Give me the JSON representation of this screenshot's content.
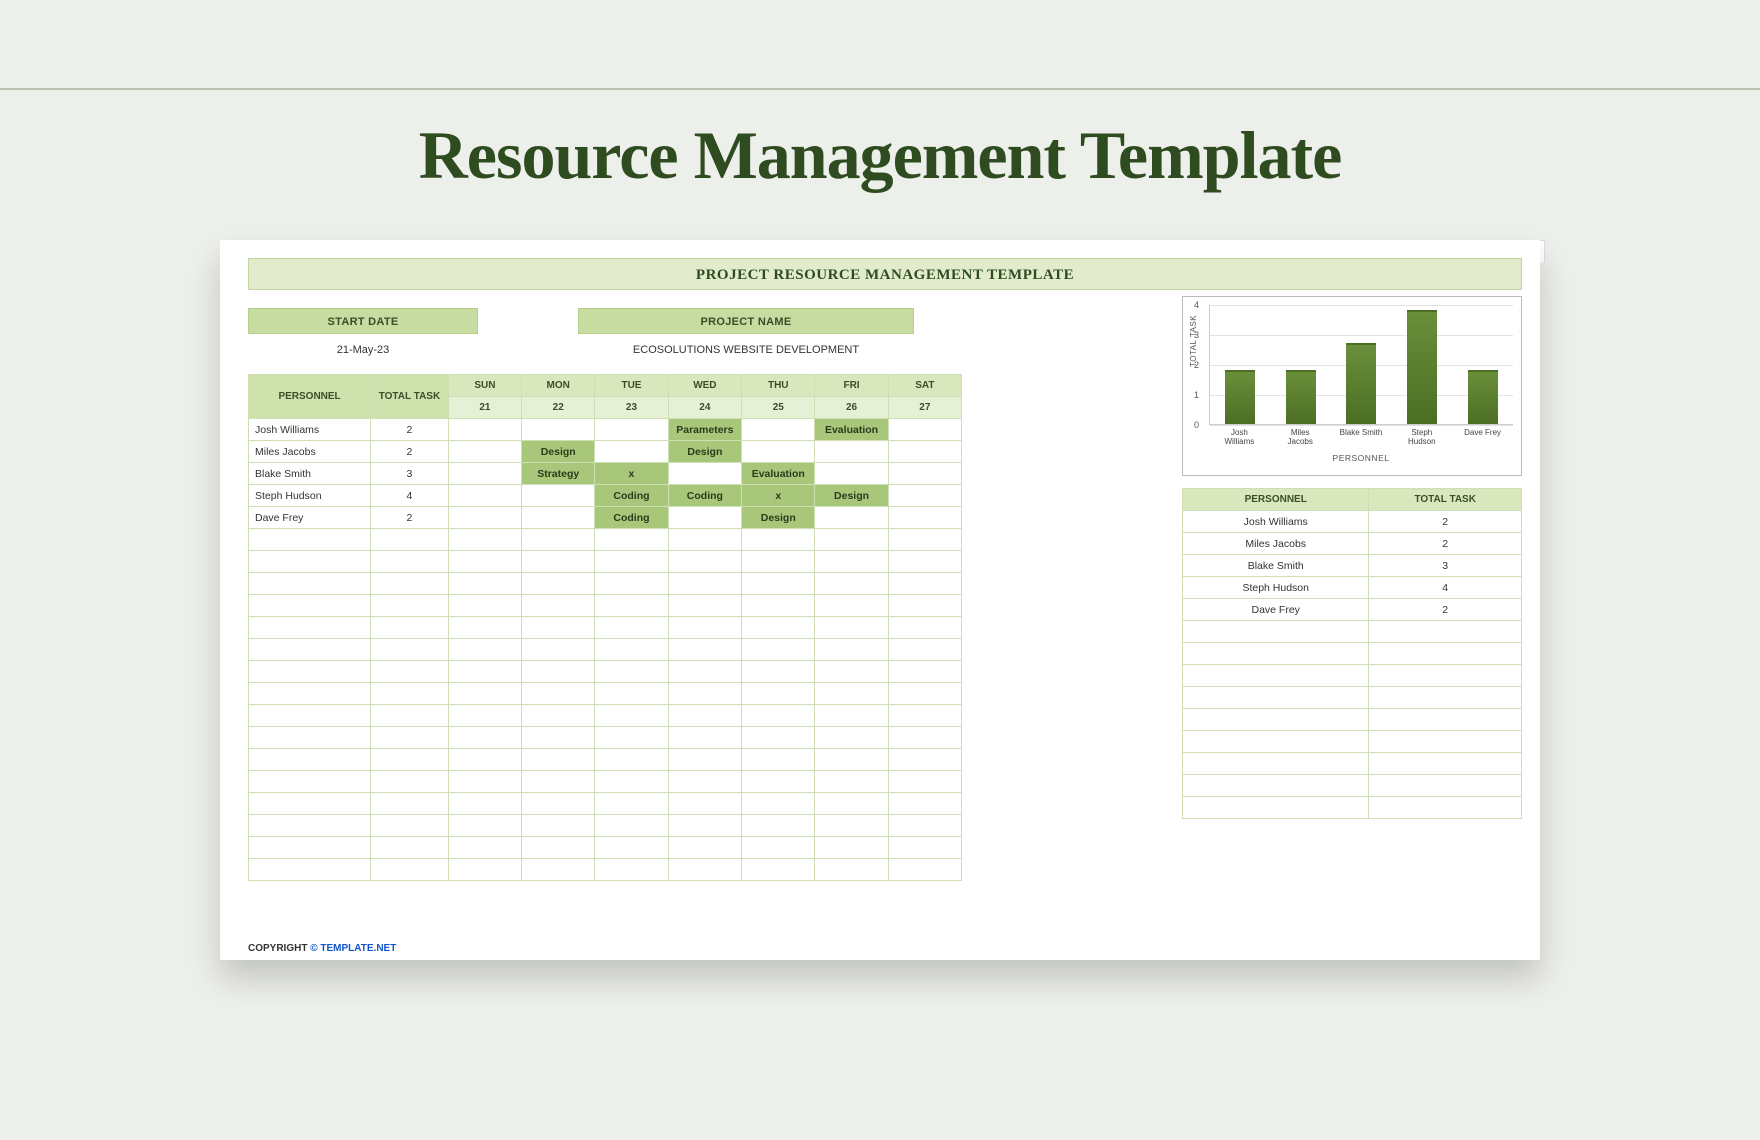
{
  "page": {
    "title": "Resource Management Template"
  },
  "sheet": {
    "banner": "PROJECT RESOURCE MANAGEMENT TEMPLATE",
    "meta": {
      "start_label": "START DATE",
      "start_value": "21-May-23",
      "project_label": "PROJECT NAME",
      "project_value": "ECOSOLUTIONS WEBSITE DEVELOPMENT"
    },
    "columns": {
      "personnel": "PERSONNEL",
      "total_task": "TOTAL TASK",
      "days": [
        "SUN",
        "MON",
        "TUE",
        "WED",
        "THU",
        "FRI",
        "SAT"
      ],
      "daynums": [
        "21",
        "22",
        "23",
        "24",
        "25",
        "26",
        "27"
      ]
    },
    "rows": [
      {
        "name": "Josh Williams",
        "total": "2",
        "cells": [
          "",
          "",
          "",
          "Parameters",
          "",
          "Evaluation",
          ""
        ]
      },
      {
        "name": "Miles Jacobs",
        "total": "2",
        "cells": [
          "",
          "Design",
          "",
          "Design",
          "",
          "",
          ""
        ]
      },
      {
        "name": "Blake Smith",
        "total": "3",
        "cells": [
          "",
          "Strategy",
          "x",
          "",
          "Evaluation",
          "",
          ""
        ]
      },
      {
        "name": "Steph Hudson",
        "total": "4",
        "cells": [
          "",
          "",
          "Coding",
          "Coding",
          "x",
          "Design",
          ""
        ]
      },
      {
        "name": "Dave Frey",
        "total": "2",
        "cells": [
          "",
          "",
          "Coding",
          "",
          "Design",
          "",
          ""
        ]
      }
    ],
    "blank_rows": 16,
    "summary_blank_rows": 9
  },
  "summary": {
    "headers": {
      "personnel": "PERSONNEL",
      "total_task": "TOTAL TASK"
    },
    "rows": [
      {
        "name": "Josh Williams",
        "total": "2"
      },
      {
        "name": "Miles Jacobs",
        "total": "2"
      },
      {
        "name": "Blake Smith",
        "total": "3"
      },
      {
        "name": "Steph Hudson",
        "total": "4"
      },
      {
        "name": "Dave Frey",
        "total": "2"
      }
    ]
  },
  "chart_data": {
    "type": "bar",
    "categories": [
      "Josh Williams",
      "Miles Jacobs",
      "Blake Smith",
      "Steph Hudson",
      "Dave Frey"
    ],
    "values": [
      1.8,
      1.8,
      2.7,
      3.8,
      1.8
    ],
    "title": "",
    "xlabel": "PERSONNEL",
    "ylabel": "TOTAL TASK",
    "ylim": [
      0,
      4
    ],
    "y_ticks": [
      0,
      1,
      2,
      3,
      4
    ]
  },
  "footer": {
    "copyright_label": "COPYRIGHT ",
    "link_symbol": "© ",
    "link_text": "TEMPLATE.NET"
  }
}
